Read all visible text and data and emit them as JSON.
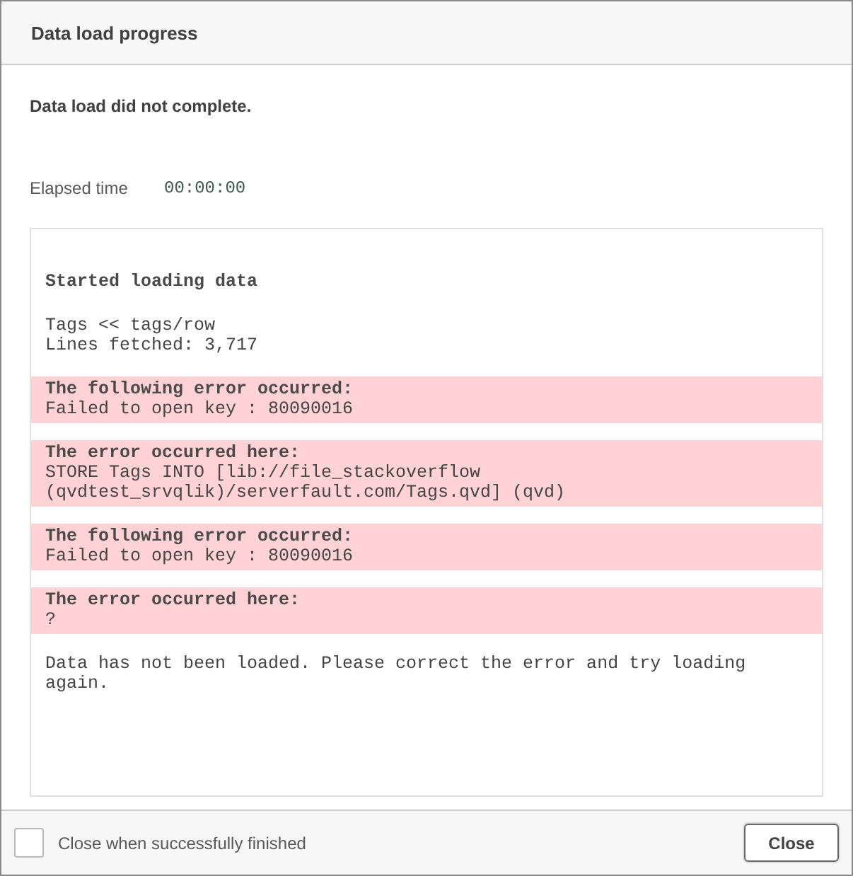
{
  "window": {
    "title": "Data load progress"
  },
  "status": "Data load did not complete.",
  "elapsed": {
    "label": "Elapsed time",
    "value": "00:00:00"
  },
  "log": [
    {
      "kind": "plain",
      "heading": "Started loading data"
    },
    {
      "kind": "plain",
      "lines": [
        "Tags << tags/row",
        "Lines fetched: 3,717"
      ]
    },
    {
      "kind": "error",
      "heading": "The following error occurred:",
      "lines": [
        "Failed to open key : 80090016"
      ]
    },
    {
      "kind": "error",
      "heading": "The error occurred here:",
      "lines": [
        "STORE Tags INTO [lib://file_stackoverflow",
        "(qvdtest_srvqlik)/serverfault.com/Tags.qvd] (qvd)"
      ]
    },
    {
      "kind": "error",
      "heading": "The following error occurred:",
      "lines": [
        "Failed to open key : 80090016"
      ]
    },
    {
      "kind": "error",
      "heading": "The error occurred here:",
      "lines": [
        "?"
      ]
    },
    {
      "kind": "plain",
      "lines": [
        "Data has not been loaded. Please correct the error and try loading again."
      ]
    }
  ],
  "footer": {
    "checkbox": {
      "label": "Close when successfully finished",
      "checked": false
    },
    "buttons": [
      "Close"
    ]
  }
}
